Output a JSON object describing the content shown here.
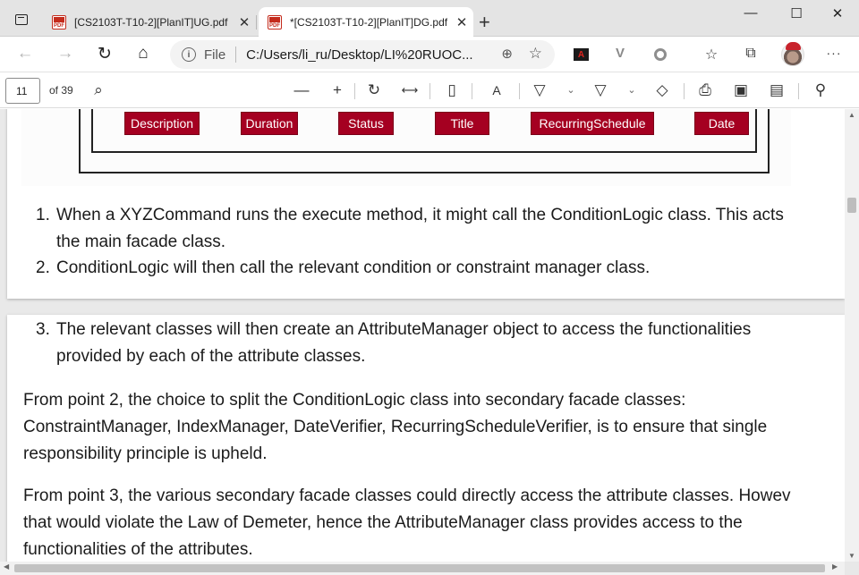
{
  "browser": {
    "tabs": [
      {
        "title": "[CS2103T-T10-2][PlanIT]UG.pdf",
        "icon": "pdf-icon",
        "active": false
      },
      {
        "title": "*[CS2103T-T10-2][PlanIT]DG.pdf",
        "icon": "pdf-icon",
        "active": true
      }
    ],
    "window_controls": {
      "minimize": "—",
      "maximize": "☐",
      "close": "✕"
    },
    "address": {
      "scheme_label": "File",
      "url": "C:/Users/li_ru/Desktop/LI%20RUOC..."
    },
    "extensions": [
      "acrobat-extension-icon",
      "vivaldi-extension-icon",
      "circle-extension-icon"
    ],
    "accent_color": "#a50021"
  },
  "pdf_toolbar": {
    "page_number": "11",
    "page_count": "of 39"
  },
  "document": {
    "diagram_attributes": [
      "Description",
      "Duration",
      "Status",
      "Title",
      "RecurringSchedule",
      "Date"
    ],
    "list_items": [
      {
        "number": "1.",
        "lines": [
          "When a XYZCommand runs the execute method, it might call the ConditionLogic class. This acts",
          "the main facade class."
        ]
      },
      {
        "number": "2.",
        "lines": [
          "ConditionLogic will then call the relevant condition or constraint manager class."
        ]
      },
      {
        "number": "3.",
        "lines": [
          "The relevant classes will then create an AttributeManager object to access the functionalities",
          "provided by each of the attribute classes."
        ]
      }
    ],
    "paragraphs": [
      [
        "From point 2, the choice to split the ConditionLogic class into secondary facade classes:",
        "ConstraintManager, IndexManager, DateVerifier, RecurringScheduleVerifier, is to ensure that single",
        "responsibility principle is upheld."
      ],
      [
        "From point 3, the various secondary facade classes could directly access the attribute classes. Howev",
        "that would violate the Law of Demeter, hence the AttributeManager class provides access to the",
        "functionalities of the attributes."
      ]
    ]
  }
}
